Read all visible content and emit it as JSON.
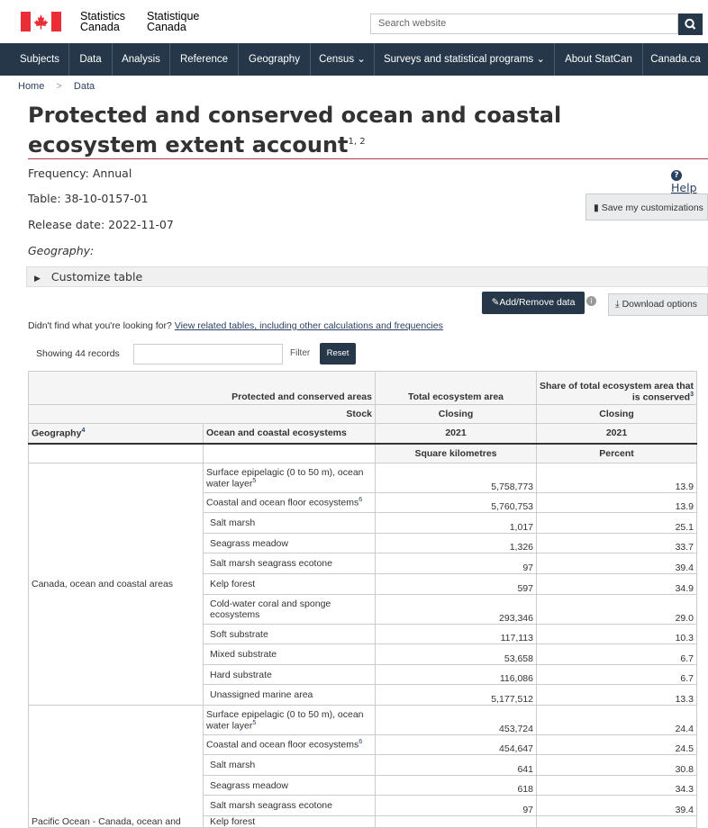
{
  "header": {
    "wordmark_en_line1": "Statistics",
    "wordmark_en_line2": "Canada",
    "wordmark_fr_line1": "Statistique",
    "wordmark_fr_line2": "Canada",
    "search_placeholder": "Search website",
    "flag_color": "#eb2d37"
  },
  "nav": {
    "items": [
      {
        "label": "Subjects"
      },
      {
        "label": "Data"
      },
      {
        "label": "Analysis"
      },
      {
        "label": "Reference"
      },
      {
        "label": "Geography"
      },
      {
        "label": "Census ⌄"
      },
      {
        "label": "Surveys and statistical programs ⌄"
      },
      {
        "label": "About StatCan"
      },
      {
        "label": "Canada.ca"
      }
    ],
    "bg_color": "#26374a"
  },
  "breadcrumb": {
    "home": "Home",
    "data": "Data",
    "sep": ">"
  },
  "page": {
    "title": "Protected and conserved ocean and coastal ecosystem extent account",
    "title_fn": "1, 2",
    "frequency": "Frequency: Annual",
    "table_id": "Table: 38-10-0157-01",
    "release": "Release date: 2022-11-07",
    "geography": "Geography:",
    "help": "Help",
    "save": "Save my customizations",
    "customize": "Customize table",
    "add_remove": "Add/Remove data",
    "download": "Download options",
    "related_prefix": "Didn't find what you're looking for?",
    "related_link": "View related tables, including other calculations and frequencies",
    "showing": "Showing 44 records",
    "filter": "Filter",
    "reset": "Reset"
  },
  "table": {
    "head": {
      "col_stub": "Protected and conserved areas",
      "col_total": "Total ecosystem area",
      "col_share": "Share of total ecosystem area that is conserved",
      "col_share_fn": "3",
      "stock": "Stock",
      "closing1": "Closing",
      "closing2": "Closing",
      "geography": "Geography",
      "geography_fn": "4",
      "ecosystems": "Ocean and coastal ecosystems",
      "year1": "2021",
      "year2": "2021",
      "unit1": "Square kilometres",
      "unit2": "Percent"
    },
    "geo1": "Canada, ocean and coastal areas",
    "geo2": "Pacific Ocean - Canada, ocean and",
    "rows1": [
      {
        "eco": "Surface epipelagic (0 to 50 m), ocean water layer",
        "fn": "5",
        "total": "5,758,773",
        "share": "13.9"
      },
      {
        "eco": "Coastal and ocean floor ecosystems",
        "fn": "6",
        "total": "5,760,753",
        "share": "13.9"
      },
      {
        "eco": "Salt marsh",
        "fn": "",
        "total": "1,017",
        "share": "25.1"
      },
      {
        "eco": "Seagrass meadow",
        "fn": "",
        "total": "1,326",
        "share": "33.7"
      },
      {
        "eco": "Salt marsh seagrass ecotone",
        "fn": "",
        "total": "97",
        "share": "39.4"
      },
      {
        "eco": "Kelp forest",
        "fn": "",
        "total": "597",
        "share": "34.9"
      },
      {
        "eco": "Cold-water coral and sponge ecosystems",
        "fn": "",
        "total": "293,346",
        "share": "29.0"
      },
      {
        "eco": "Soft substrate",
        "fn": "",
        "total": "117,113",
        "share": "10.3"
      },
      {
        "eco": "Mixed substrate",
        "fn": "",
        "total": "53,658",
        "share": "6.7"
      },
      {
        "eco": "Hard substrate",
        "fn": "",
        "total": "116,086",
        "share": "6.7"
      },
      {
        "eco": "Unassigned marine area",
        "fn": "",
        "total": "5,177,512",
        "share": "13.3"
      }
    ],
    "rows2": [
      {
        "eco": "Surface epipelagic (0 to 50 m), ocean water layer",
        "fn": "5",
        "total": "453,724",
        "share": "24.4"
      },
      {
        "eco": "Coastal and ocean floor ecosystems",
        "fn": "6",
        "total": "454,647",
        "share": "24.5"
      },
      {
        "eco": "Salt marsh",
        "fn": "",
        "total": "641",
        "share": "30.8"
      },
      {
        "eco": "Seagrass meadow",
        "fn": "",
        "total": "618",
        "share": "34.3"
      },
      {
        "eco": "Salt marsh seagrass ecotone",
        "fn": "",
        "total": "97",
        "share": "39.4"
      },
      {
        "eco": "Kelp forest",
        "fn": "",
        "total": "",
        "share": ""
      }
    ]
  }
}
